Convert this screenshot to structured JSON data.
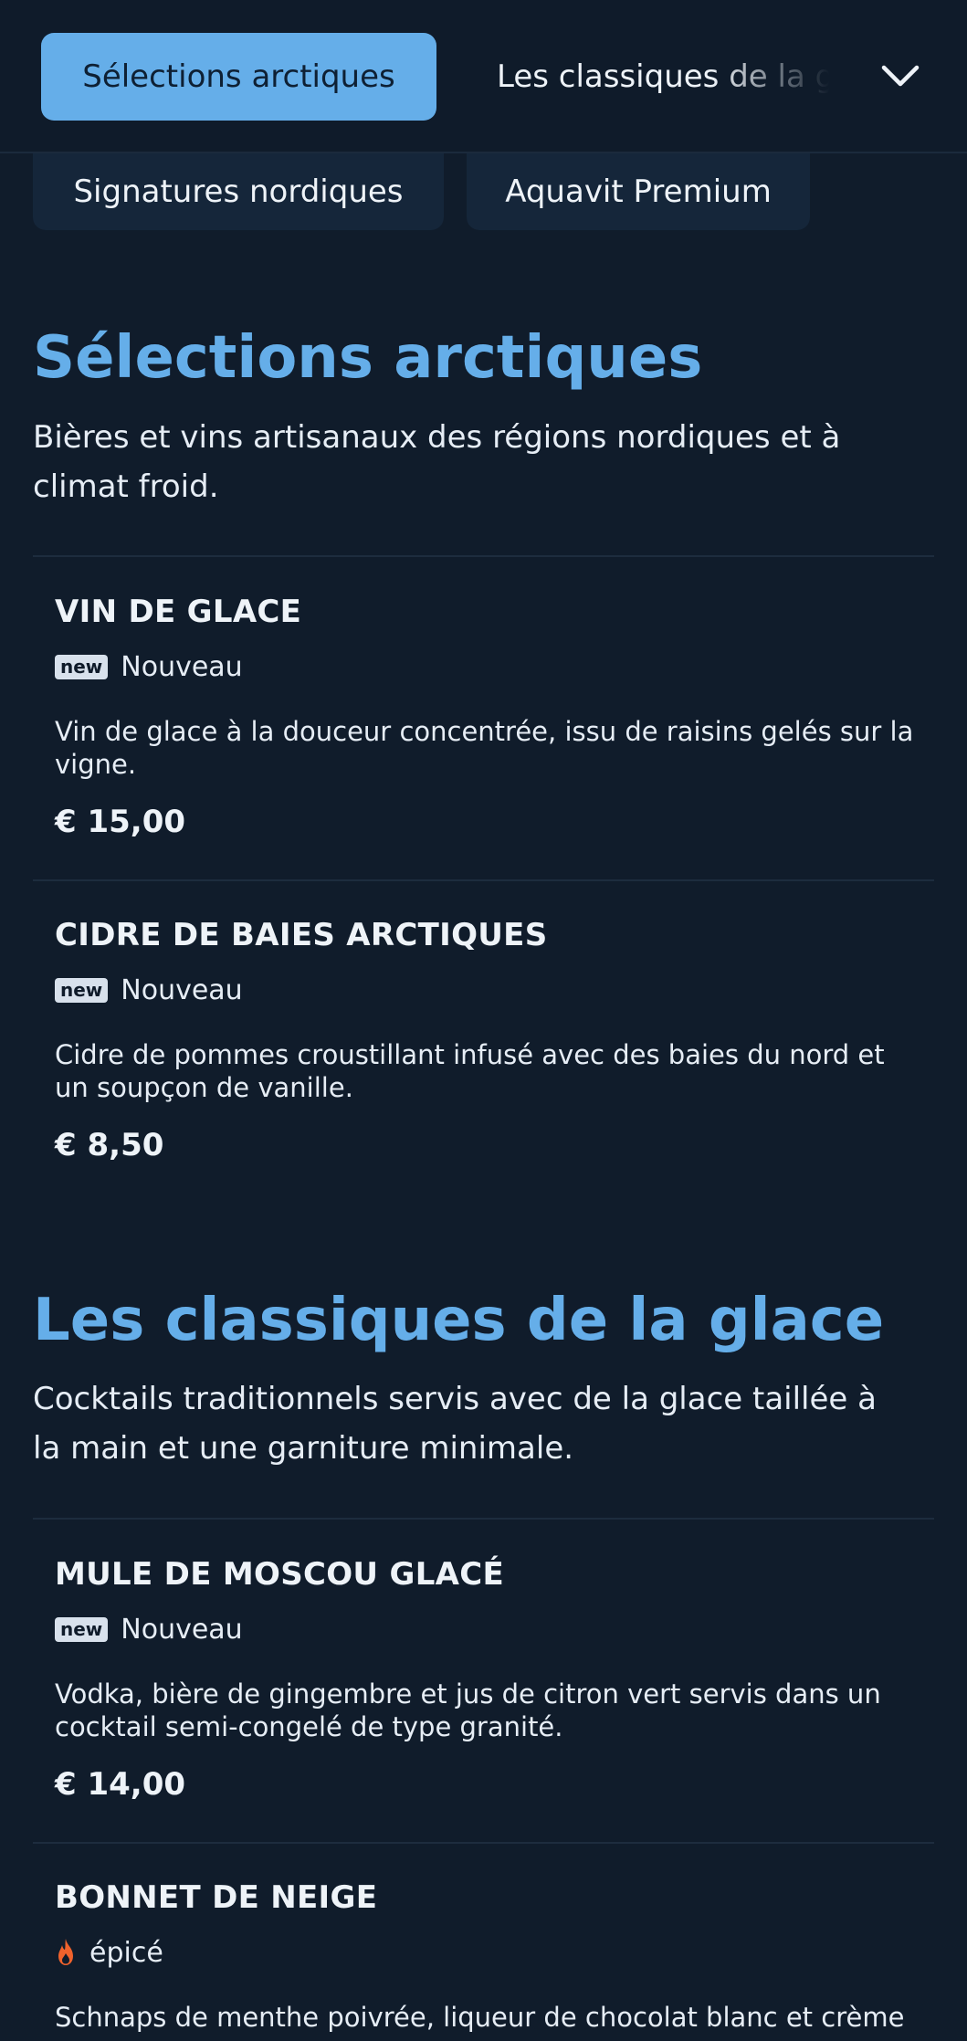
{
  "topbar": {
    "active_tab": "Sélections arctiques",
    "next_tab": "Les classiques de la glace",
    "chevron_icon": "chevron-down-icon"
  },
  "chips": [
    {
      "label": "Signatures nordiques"
    },
    {
      "label": "Aquavit Premium"
    }
  ],
  "sections": [
    {
      "title": "Sélections arctiques",
      "description": "Bières et vins artisanaux des régions nordiques et à climat froid.",
      "items": [
        {
          "name": "VIN DE GLACE",
          "badge": "new",
          "tag": "Nouveau",
          "description": "Vin de glace à la douceur concentrée, issu de raisins gelés sur la vigne.",
          "price": "€ 15,00"
        },
        {
          "name": "CIDRE DE BAIES ARCTIQUES",
          "badge": "new",
          "tag": "Nouveau",
          "description": "Cidre de pommes croustillant infusé avec des baies du nord et un soupçon de vanille.",
          "price": "€ 8,50"
        }
      ]
    },
    {
      "title": "Les classiques de la glace",
      "description": "Cocktails traditionnels servis avec de la glace taillée à la main et une garniture minimale.",
      "items": [
        {
          "name": "MULE DE MOSCOU GLACÉ",
          "badge": "new",
          "tag": "Nouveau",
          "description": "Vodka, bière de gingembre et jus de citron vert servis dans un cocktail semi-congelé de type granité.",
          "price": "€ 14,00"
        },
        {
          "name": "BONNET DE NEIGE",
          "icon": "flame-icon",
          "tag": "épicé",
          "description": "Schnaps de menthe poivrée, liqueur de chocolat blanc et crème"
        }
      ]
    }
  ],
  "colors": {
    "background": "#101c2b",
    "accent": "#65aee9",
    "chip": "#15263a",
    "flame": "#f0622c"
  }
}
